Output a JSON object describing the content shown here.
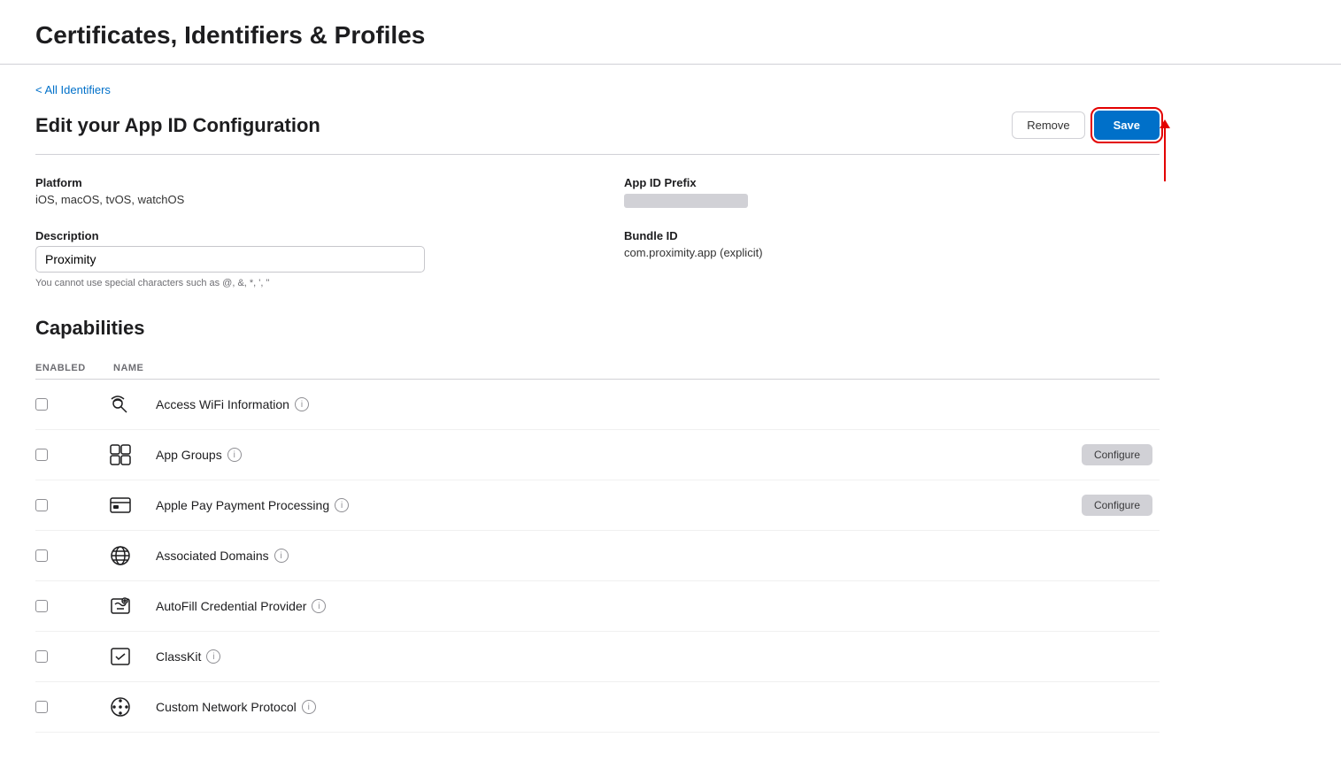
{
  "header": {
    "title": "Certificates, Identifiers & Profiles"
  },
  "breadcrumb": {
    "label": "< All Identifiers",
    "href": "#"
  },
  "form": {
    "section_title": "Edit your App ID Configuration",
    "remove_label": "Remove",
    "save_label": "Save",
    "platform_label": "Platform",
    "platform_value": "iOS, macOS, tvOS, watchOS",
    "app_id_prefix_label": "App ID Prefix",
    "description_label": "Description",
    "description_value": "Proximity",
    "description_hint": "You cannot use special characters such as @, &, *, ', \"",
    "bundle_id_label": "Bundle ID",
    "bundle_id_value": "com.proximity.app (explicit)"
  },
  "capabilities": {
    "title": "Capabilities",
    "col_enabled": "ENABLED",
    "col_name": "NAME",
    "items": [
      {
        "id": "access-wifi",
        "name": "Access WiFi Information",
        "has_info": true,
        "has_configure": false,
        "enabled": false,
        "icon": "wifi-search"
      },
      {
        "id": "app-groups",
        "name": "App Groups",
        "has_info": true,
        "has_configure": true,
        "enabled": false,
        "icon": "app-groups"
      },
      {
        "id": "apple-pay",
        "name": "Apple Pay Payment Processing",
        "has_info": true,
        "has_configure": true,
        "enabled": false,
        "icon": "apple-pay"
      },
      {
        "id": "associated-domains",
        "name": "Associated Domains",
        "has_info": true,
        "has_configure": false,
        "enabled": false,
        "icon": "globe"
      },
      {
        "id": "autofill",
        "name": "AutoFill Credential Provider",
        "has_info": true,
        "has_configure": false,
        "enabled": false,
        "icon": "autofill"
      },
      {
        "id": "classkit",
        "name": "ClassKit",
        "has_info": true,
        "has_configure": false,
        "enabled": false,
        "icon": "classkit"
      },
      {
        "id": "custom-network",
        "name": "Custom Network Protocol",
        "has_info": true,
        "has_configure": false,
        "enabled": false,
        "icon": "custom-network"
      }
    ],
    "configure_label": "Configure"
  }
}
